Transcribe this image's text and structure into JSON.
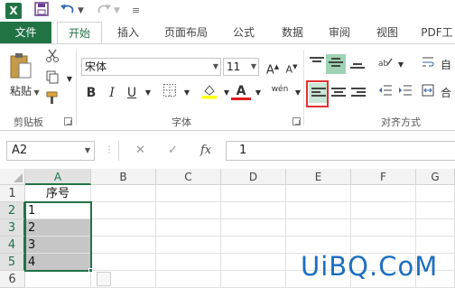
{
  "qat": {
    "app_icon": "X",
    "save_icon": "save-icon",
    "undo_icon": "undo-icon",
    "redo_icon": "redo-icon"
  },
  "tabs": [
    {
      "label": "文件"
    },
    {
      "label": "开始"
    },
    {
      "label": "插入"
    },
    {
      "label": "页面布局"
    },
    {
      "label": "公式"
    },
    {
      "label": "数据"
    },
    {
      "label": "审阅"
    },
    {
      "label": "视图"
    },
    {
      "label": "PDF工"
    }
  ],
  "ribbon": {
    "clipboard": {
      "paste_label": "粘贴",
      "group_label": "剪贴板"
    },
    "font": {
      "font_name": "宋体",
      "font_size": "11",
      "group_label": "字体",
      "bold": "B",
      "italic": "I",
      "underline": "U",
      "grow": "A",
      "shrink": "A",
      "phonetic": "wén"
    },
    "alignment": {
      "group_label": "对齐方式",
      "wrap_label": "自",
      "merge_label": "合"
    }
  },
  "formula_bar": {
    "name_box": "A2",
    "cancel": "✕",
    "enter": "✓",
    "fx": "fx",
    "value": "1"
  },
  "grid": {
    "columns": [
      "A",
      "B",
      "C",
      "D",
      "E",
      "F",
      "G"
    ],
    "rows": [
      "1",
      "2",
      "3",
      "4",
      "5",
      "6"
    ],
    "cells": {
      "A1": "序号",
      "A2": "1",
      "A3": "2",
      "A4": "3",
      "A5": "4"
    }
  },
  "watermark": "UiBQ.CoM",
  "colors": {
    "accent": "#217346",
    "highlight_box": "#e03131",
    "selection_fill": "#c6c6c6",
    "watermark": "#1c6fc0"
  }
}
